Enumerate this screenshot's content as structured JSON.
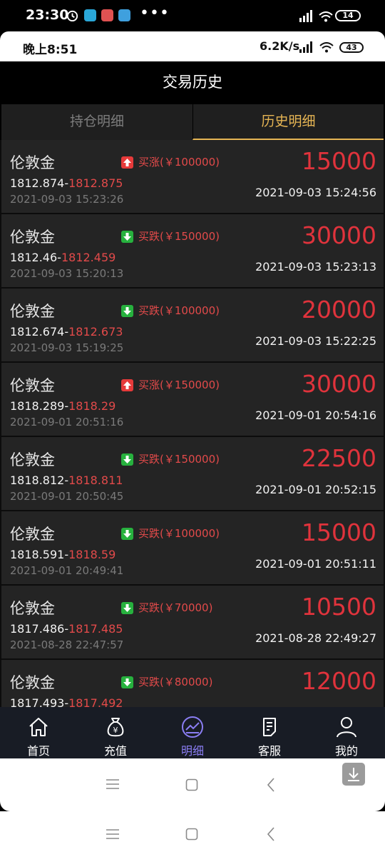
{
  "system_status": {
    "time": "23:30",
    "battery": "14",
    "more": "•••"
  },
  "inner_status": {
    "time": "晚上8:51",
    "speed": "6.2K/s",
    "battery": "43"
  },
  "header": {
    "title": "交易历史"
  },
  "tabs": [
    {
      "label": "持仓明细"
    },
    {
      "label": "历史明细"
    }
  ],
  "trades": [
    {
      "name": "伦敦金",
      "direction": "up",
      "direction_label": "买涨(￥100000)",
      "open_price": "1812.874",
      "close_price": "1812.875",
      "open_time": "2021-09-03 15:23:26",
      "profit": "15000",
      "close_time": "2021-09-03 15:24:56"
    },
    {
      "name": "伦敦金",
      "direction": "down",
      "direction_label": "买跌(￥150000)",
      "open_price": "1812.46",
      "close_price": "1812.459",
      "open_time": "2021-09-03 15:20:13",
      "profit": "30000",
      "close_time": "2021-09-03 15:23:13"
    },
    {
      "name": "伦敦金",
      "direction": "down",
      "direction_label": "买跌(￥100000)",
      "open_price": "1812.674",
      "close_price": "1812.673",
      "open_time": "2021-09-03 15:19:25",
      "profit": "20000",
      "close_time": "2021-09-03 15:22:25"
    },
    {
      "name": "伦敦金",
      "direction": "up",
      "direction_label": "买涨(￥150000)",
      "open_price": "1818.289",
      "close_price": "1818.29",
      "open_time": "2021-09-01 20:51:16",
      "profit": "30000",
      "close_time": "2021-09-01 20:54:16"
    },
    {
      "name": "伦敦金",
      "direction": "down",
      "direction_label": "买跌(￥150000)",
      "open_price": "1818.812",
      "close_price": "1818.811",
      "open_time": "2021-09-01 20:50:45",
      "profit": "22500",
      "close_time": "2021-09-01 20:52:15"
    },
    {
      "name": "伦敦金",
      "direction": "down",
      "direction_label": "买跌(￥100000)",
      "open_price": "1818.591",
      "close_price": "1818.59",
      "open_time": "2021-09-01 20:49:41",
      "profit": "15000",
      "close_time": "2021-09-01 20:51:11"
    },
    {
      "name": "伦敦金",
      "direction": "down",
      "direction_label": "买跌(￥70000)",
      "open_price": "1817.486",
      "close_price": "1817.485",
      "open_time": "2021-08-28 22:47:57",
      "profit": "10500",
      "close_time": "2021-08-28 22:49:27"
    },
    {
      "name": "伦敦金",
      "direction": "down",
      "direction_label": "买跌(￥80000)",
      "open_price": "1817.493",
      "close_price": "1817.492",
      "open_time": "",
      "profit": "12000",
      "close_time": ""
    }
  ],
  "bottom_nav": [
    {
      "label": "首页",
      "icon": "home-icon"
    },
    {
      "label": "充值",
      "icon": "money-bag-icon"
    },
    {
      "label": "明细",
      "icon": "chart-trend-icon"
    },
    {
      "label": "客服",
      "icon": "document-icon"
    },
    {
      "label": "我的",
      "icon": "user-icon"
    }
  ],
  "colors": {
    "accent_gold": "#e6b554",
    "profit_red": "#e0333c",
    "down_green": "#27b13e",
    "up_red": "#e63a3a",
    "nav_active": "#8a7df2"
  }
}
